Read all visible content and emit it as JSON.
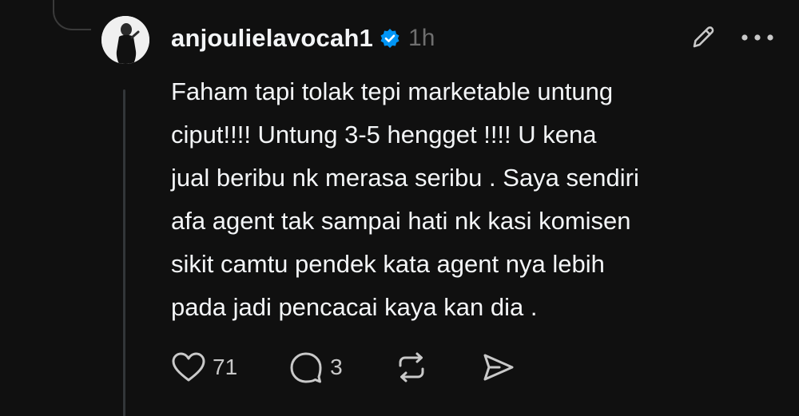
{
  "post": {
    "username": "anjoulielavocah1",
    "verified": true,
    "time": "1h",
    "text": "Faham tapi tolak tepi marketable untung\nciput!!!! Untung 3-5 hengget !!!! U kena\njual beribu nk merasa seribu . Saya sendiri\nafa agent tak sampai hati nk kasi komisen\nsikit camtu pendek kata agent nya lebih\npada jadi pencacai kaya kan dia ."
  },
  "actions": {
    "likes": "71",
    "replies": "3"
  },
  "icons": {
    "verified": "verified-badge-icon",
    "edit": "pencil-icon",
    "more": "more-dots-icon",
    "like": "heart-icon",
    "reply": "comment-bubble-icon",
    "repost": "repost-icon",
    "share": "send-icon"
  },
  "colors": {
    "background": "#101010",
    "text": "#f3f5f7",
    "muted": "#6f6f6f",
    "verified": "#0095f6"
  }
}
